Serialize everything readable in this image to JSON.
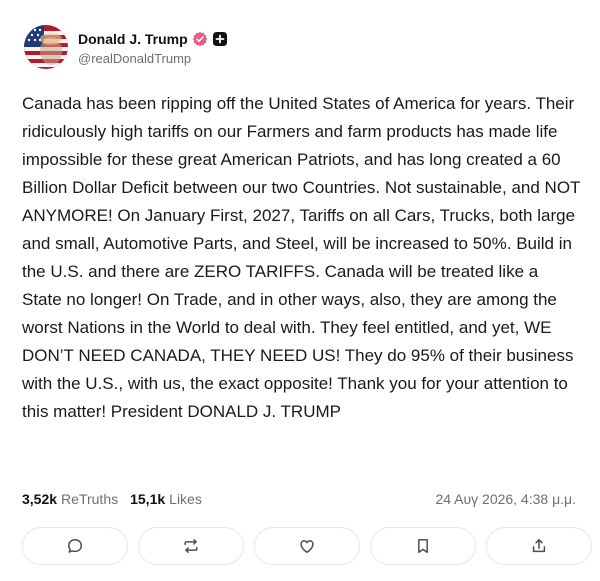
{
  "post": {
    "author": {
      "display_name": "Donald J. Trump",
      "handle": "@realDonaldTrump",
      "verified": true,
      "verified_color": "#e85c8c",
      "plus_badge": "plus-square-icon"
    },
    "text": "Canada has been ripping off the United States of America for years. Their ridiculously high tariffs on our Farmers and farm products has made life impossible for these great American Patriots, and has long created a 60 Billion Dollar Deficit between our two Countries. Not sustainable, and NOT ANYMORE! On January First, 2027, Tariffs on all Cars, Trucks, both large and small, Automotive Parts, and Steel, will be increased to 50%. Build in the U.S. and there are ZERO TARIFFS. Canada will be treated like a State no longer! On Trade, and in other ways, also, they are among the worst Nations in the World to deal with. They feel entitled, and yet, WE DON’T NEED CANADA, THEY NEED US! They do 95% of their business with the U.S., with us, the exact opposite! Thank you for your attention to this matter! President DONALD J. TRUMP",
    "stats": {
      "retruths_count": "3,52k",
      "retruths_label": "ReTruths",
      "likes_count": "15,1k",
      "likes_label": "Likes"
    },
    "timestamp": "24 Αυγ 2026, 4:38 μ.μ."
  },
  "actions": [
    {
      "name": "reply",
      "icon": "comment-icon"
    },
    {
      "name": "retruth",
      "icon": "retruth-icon"
    },
    {
      "name": "like",
      "icon": "heart-icon"
    },
    {
      "name": "bookmark",
      "icon": "bookmark-icon"
    },
    {
      "name": "share",
      "icon": "share-icon"
    }
  ]
}
